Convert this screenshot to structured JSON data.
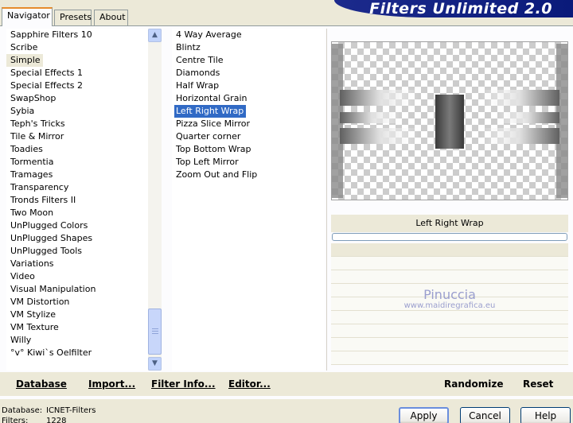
{
  "tabs": [
    {
      "label": "Navigator"
    },
    {
      "label": "Presets"
    },
    {
      "label": "About"
    }
  ],
  "app_title": "Filters Unlimited 2.0",
  "categories": [
    "Sapphire Filters 10",
    "Scribe",
    "Simple",
    "Special Effects 1",
    "Special Effects 2",
    "SwapShop",
    "Sybia",
    "Teph's Tricks",
    "Tile & Mirror",
    "Toadies",
    "Tormentia",
    "Tramages",
    "Transparency",
    "Tronds Filters II",
    "Two Moon",
    "UnPlugged Colors",
    "UnPlugged Shapes",
    "UnPlugged Tools",
    "Variations",
    "Video",
    "Visual Manipulation",
    "VM Distortion",
    "VM Stylize",
    "VM Texture",
    "Willy",
    "°v° Kiwi`s Oelfilter"
  ],
  "selected_category": "Simple",
  "filters": [
    "4 Way Average",
    "Blintz",
    "Centre Tile",
    "Diamonds",
    "Half Wrap",
    "Horizontal Grain",
    "Left Right Wrap",
    "Pizza Slice Mirror",
    "Quarter corner",
    "Top Bottom Wrap",
    "Top Left Mirror",
    "Zoom Out and Flip"
  ],
  "selected_filter": "Left Right Wrap",
  "preview": {
    "filter_name": "Left Right Wrap"
  },
  "watermark": {
    "line1": "Pinuccia",
    "line2": "www.maidiregrafica.eu"
  },
  "bottom_buttons": {
    "database": "Database",
    "import": "Import...",
    "filter_info": "Filter Info...",
    "editor": "Editor...",
    "randomize": "Randomize",
    "reset": "Reset"
  },
  "status": {
    "database_label": "Database:",
    "database_value": "ICNET-Filters",
    "filters_label": "Filters:",
    "filters_value": "1228"
  },
  "dialog_buttons": {
    "apply": "Apply",
    "cancel": "Cancel",
    "help": "Help"
  },
  "colors": {
    "title_banner": "#0A1A7A",
    "selection": "#316AC5",
    "window_bg": "#ECE9D8"
  }
}
